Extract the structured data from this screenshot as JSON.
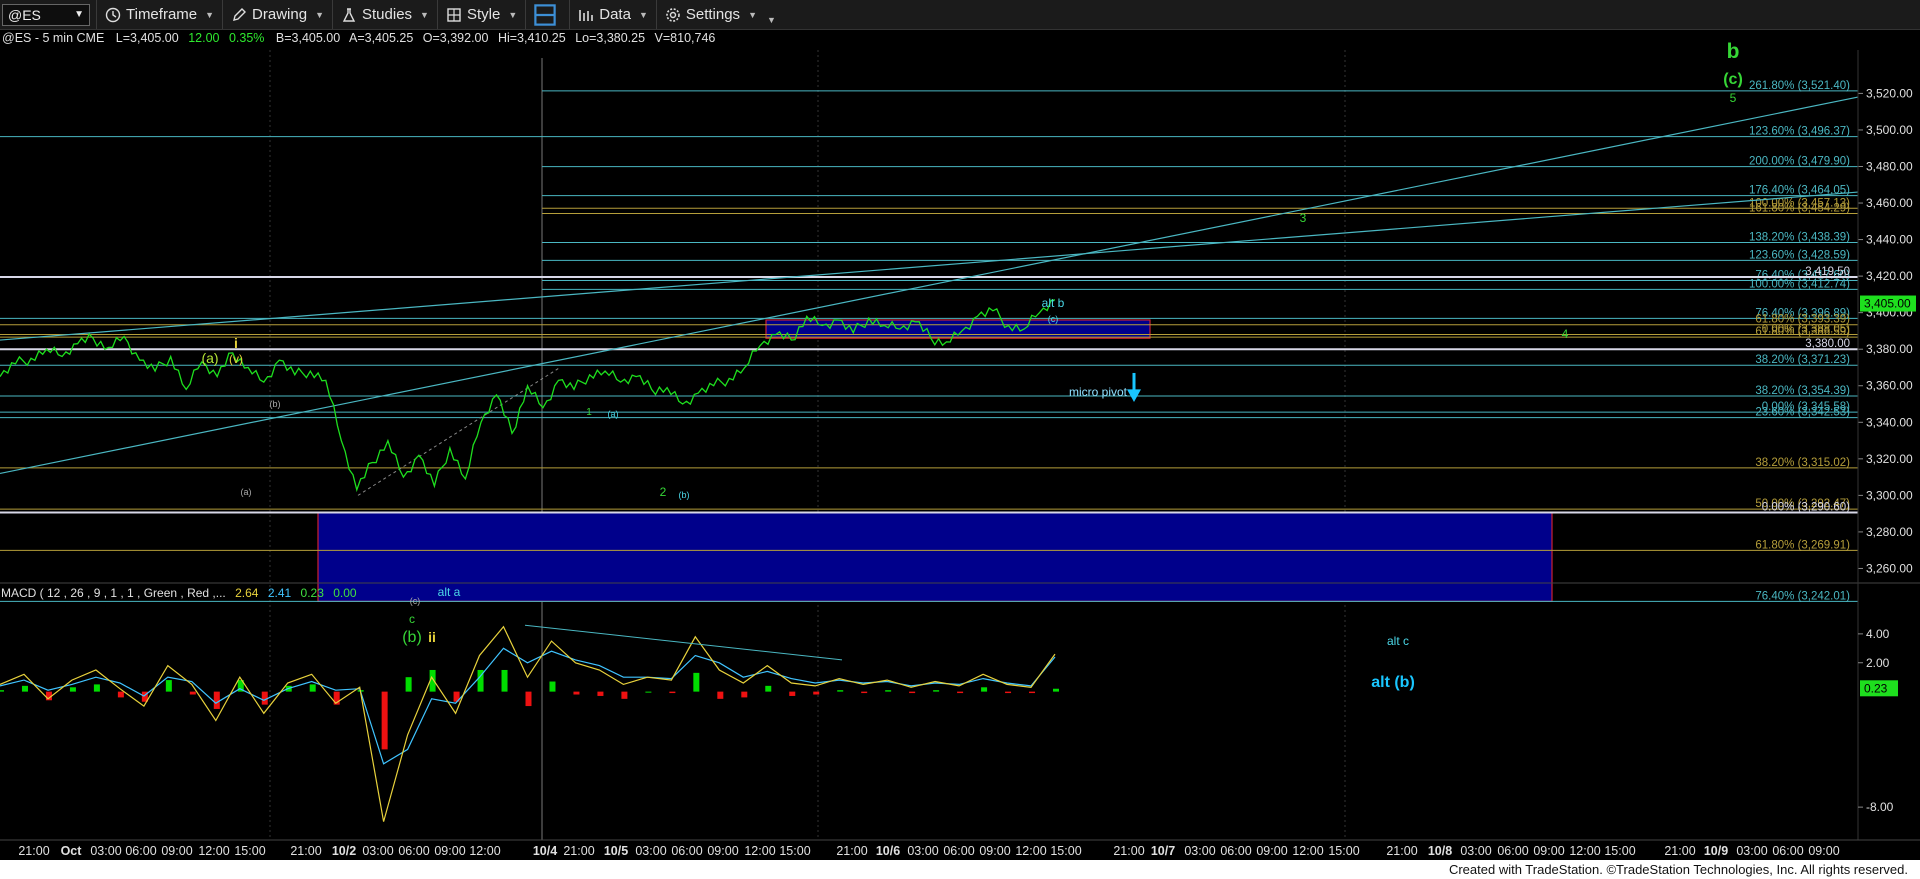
{
  "toolbar": {
    "symbol": "@ES",
    "items": [
      "Timeframe",
      "Drawing",
      "Studies",
      "Style",
      "Data",
      "Settings"
    ]
  },
  "header": {
    "symbol_desc": "@ES - 5 min  CME",
    "last": "L=3,405.00",
    "change": "12.00",
    "pct": "0.35%",
    "bid": "B=3,405.00",
    "ask": "A=3,405.25",
    "open": "O=3,392.00",
    "high": "Hi=3,410.25",
    "low": "Lo=3,380.25",
    "volume": "V=810,746"
  },
  "footer": "Created with TradeStation. ©TradeStation Technologies, Inc. All rights reserved.",
  "colors": {
    "price": "#1edf1e",
    "fib_cyan": "#4ab7c2",
    "fib_gold": "#b59e3a",
    "zone": "#00008b",
    "macd_pos": "#00dd00",
    "macd_neg": "#ee1111"
  },
  "chart_data": [
    {
      "type": "line",
      "title": "@ES - 5 min  CME",
      "ylim": [
        3240,
        3535
      ],
      "y_ticks": [
        3520,
        3500,
        3480,
        3460,
        3440,
        3420,
        3400,
        3380,
        3360,
        3340,
        3320,
        3300,
        3280,
        3260
      ],
      "y_tick_labels": [
        "3,520.00",
        "3,500.00",
        "3,480.00",
        "3,460.00",
        "3,440.00",
        "3,420.00",
        "3,400.00",
        "3,380.00",
        "3,360.00",
        "3,340.00",
        "3,320.00",
        "3,300.00",
        "3,280.00",
        "3,260.00"
      ],
      "x_tick_labels": [
        "21:00",
        "Oct",
        "03:00",
        "06:00",
        "09:00",
        "12:00",
        "15:00",
        "21:00",
        "10/2",
        "03:00",
        "06:00",
        "09:00",
        "12:00",
        "10/4",
        "21:00",
        "10/5",
        "03:00",
        "06:00",
        "09:00",
        "12:00",
        "15:00",
        "21:00",
        "10/6",
        "03:00",
        "06:00",
        "09:00",
        "12:00",
        "15:00",
        "21:00",
        "10/7",
        "03:00",
        "06:00",
        "09:00",
        "12:00",
        "15:00",
        "21:00",
        "10/8",
        "03:00",
        "06:00",
        "09:00",
        "12:00",
        "15:00",
        "21:00",
        "10/9",
        "03:00",
        "06:00",
        "09:00"
      ],
      "series": [
        {
          "values": [
            3365,
            3372,
            3375,
            3380,
            3376,
            3383,
            3386,
            3381,
            3387,
            3374,
            3368,
            3376,
            3358,
            3373,
            3365,
            3378,
            3370,
            3362,
            3374,
            3366,
            3368,
            3363,
            3330,
            3303,
            3318,
            3330,
            3310,
            3322,
            3305,
            3326,
            3309,
            3340,
            3355,
            3334,
            3360,
            3348,
            3363,
            3358,
            3366,
            3368,
            3362,
            3365,
            3358,
            3359,
            3350,
            3356,
            3360,
            3364,
            3370,
            3382,
            3388,
            3385,
            3398,
            3393,
            3396,
            3389,
            3397,
            3393,
            3391,
            3395,
            3386,
            3384,
            3390,
            3398,
            3401,
            3393,
            3391,
            3400,
            3407
          ]
        }
      ],
      "fib_levels": [
        {
          "label": "261.80% (3,521.40)",
          "value": 3521.4,
          "color": "cyan"
        },
        {
          "label": "123.60% (3,496.37)",
          "value": 3496.37,
          "color": "cyan"
        },
        {
          "label": "200.00% (3,479.90)",
          "value": 3479.9,
          "color": "cyan"
        },
        {
          "label": "176.40% (3,464.05)",
          "value": 3464.05,
          "color": "cyan"
        },
        {
          "label": "100.00% (3,457.13)",
          "value": 3457.13,
          "color": "gold"
        },
        {
          "label": "161.80% (3,454.29)",
          "value": 3454.29,
          "color": "gold"
        },
        {
          "label": "138.20% (3,438.39)",
          "value": 3438.39,
          "color": "cyan"
        },
        {
          "label": "123.60% (3,428.59)",
          "value": 3428.59,
          "color": "cyan"
        },
        {
          "label": "76.40% (3,417.60)",
          "value": 3417.6,
          "color": "cyan"
        },
        {
          "label": "3,419.50",
          "value": 3419.5,
          "color": "white"
        },
        {
          "label": "100.00% (3,412.74)",
          "value": 3412.74,
          "color": "cyan"
        },
        {
          "label": "76.40% (3,396.89)",
          "value": 3396.89,
          "color": "cyan"
        },
        {
          "label": "61.80% (3,393.39)",
          "value": 3393.39,
          "color": "gold"
        },
        {
          "label": "0.00% (3,388.05)",
          "value": 3388.05,
          "color": "gold"
        },
        {
          "label": "61.80% (3,386.59)",
          "value": 3386.59,
          "color": "gold"
        },
        {
          "label": "3,380.00",
          "value": 3380,
          "color": "white"
        },
        {
          "label": "38.20% (3,371.23)",
          "value": 3371.23,
          "color": "cyan"
        },
        {
          "label": "38.20% (3,354.39)",
          "value": 3354.39,
          "color": "cyan"
        },
        {
          "label": "0.00% (3,345.58)",
          "value": 3345.58,
          "color": "cyan"
        },
        {
          "label": "23.60% (3,342.53)",
          "value": 3342.53,
          "color": "cyan"
        },
        {
          "label": "38.20% (3,315.02)",
          "value": 3315.02,
          "color": "gold"
        },
        {
          "label": "50.00% (3,292.47)",
          "value": 3292.47,
          "color": "gold"
        },
        {
          "label": "0.00% (3,290.60)",
          "value": 3290.6,
          "color": "white"
        },
        {
          "label": "61.80% (3,269.91)",
          "value": 3269.91,
          "color": "gold"
        },
        {
          "label": "76.40% (3,242.01)",
          "value": 3242.01,
          "color": "cyan"
        }
      ],
      "last_price_label": "3,405.00",
      "boxes": [
        {
          "label": "micro pivot",
          "top": 3396,
          "bottom": 3386
        },
        {
          "label": "alt (b)",
          "top": 3290.6,
          "bottom": 3242
        }
      ],
      "annotations": [
        "b",
        "(c)",
        "5",
        "3",
        "4",
        "alt b",
        "(c)",
        "i",
        "(a)",
        "(v)",
        "(b)",
        "(a)",
        "1",
        "(a)",
        "2",
        "(b)",
        "alt a",
        "(c)",
        "c",
        "(b)",
        "ii",
        "alt c",
        "alt (b)",
        "micro pivot"
      ]
    },
    {
      "type": "line",
      "title": "MACD ( 12 , 26 , 9 , 1 , 1 , Green , Red ,...",
      "header_values": [
        "2.64",
        "2.41",
        "0.23",
        "0.00"
      ],
      "ylim": [
        -10,
        6
      ],
      "y_ticks": [
        4,
        2,
        -8
      ],
      "y_tick_labels": [
        "4.00",
        "2.00",
        "-8.00"
      ],
      "last_value_label": "0.23",
      "series": [
        {
          "name": "MACD",
          "values": [
            0.5,
            1.2,
            -0.5,
            0.8,
            1.5,
            0.2,
            -1.0,
            1.8,
            0.5,
            -2.0,
            1.0,
            -1.5,
            0.6,
            1.2,
            -0.8,
            0.3,
            -9.0,
            -3.0,
            1.0,
            -1.5,
            2.5,
            4.5,
            1.0,
            3.5,
            2.0,
            1.5,
            0.5,
            1.0,
            0.8,
            3.8,
            1.5,
            0.6,
            1.8,
            0.6,
            0.4,
            0.9,
            0.5,
            0.8,
            0.3,
            0.7,
            0.4,
            1.2,
            0.5,
            0.3,
            2.6
          ]
        },
        {
          "name": "Signal",
          "values": [
            0.4,
            0.8,
            0.1,
            0.5,
            1.0,
            0.6,
            -0.3,
            1.0,
            0.7,
            -0.8,
            0.2,
            -0.6,
            0.2,
            0.7,
            0.1,
            0.2,
            -5.0,
            -4.0,
            -0.5,
            -0.8,
            1.0,
            3.0,
            2.0,
            2.8,
            2.2,
            1.8,
            1.0,
            1.0,
            0.9,
            2.5,
            2.0,
            1.0,
            1.4,
            0.9,
            0.6,
            0.8,
            0.6,
            0.7,
            0.4,
            0.6,
            0.5,
            0.9,
            0.6,
            0.4,
            2.4
          ]
        }
      ]
    }
  ]
}
